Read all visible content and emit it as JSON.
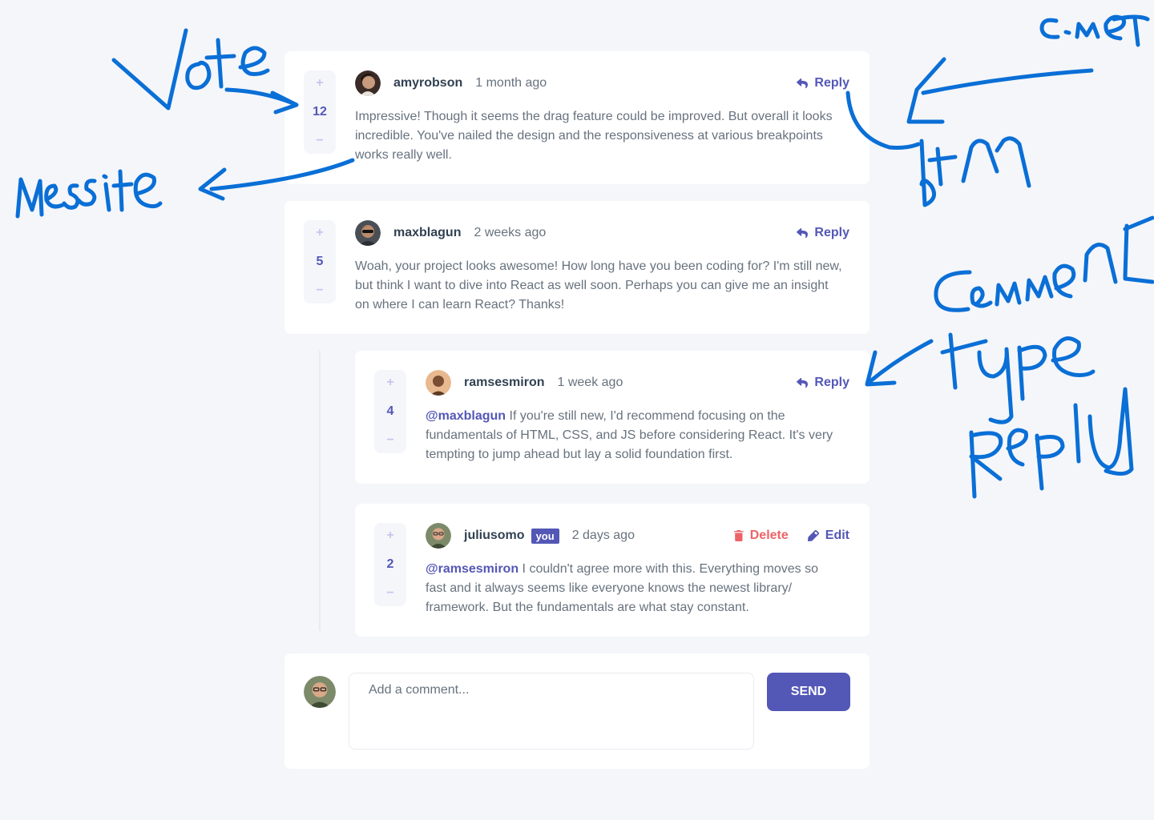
{
  "colors": {
    "moderate_blue": "#5357b6",
    "light_grayish_blue": "#c5c6ef",
    "soft_red": "#ed6368",
    "dark_blue": "#324152",
    "grayish_blue": "#67727e",
    "annotation_blue": "#0a6fd6"
  },
  "comments": [
    {
      "score": "12",
      "username": "amyrobson",
      "time": "1 month ago",
      "reply_label": "Reply",
      "content": "Impressive! Though it seems the drag feature could be improved. But overall it looks incredible. You've nailed the design and the responsiveness at various breakpoints works really well."
    },
    {
      "score": "5",
      "username": "maxblagun",
      "time": "2 weeks ago",
      "reply_label": "Reply",
      "content": "Woah, your project looks awesome! How long have you been coding for? I'm still new, but think I want to dive into React as well soon. Perhaps you can give me an insight on where I can learn React? Thanks!"
    }
  ],
  "replies": [
    {
      "score": "4",
      "username": "ramsesmiron",
      "time": "1 week ago",
      "reply_label": "Reply",
      "mention": "@maxblagun",
      "content": "If you're still new, I'd recommend focusing on the fundamentals of HTML, CSS, and JS before considering React. It's very tempting to jump ahead but lay a solid foundation first."
    },
    {
      "score": "2",
      "username": "juliusomo",
      "you_label": "you",
      "time": "2 days ago",
      "delete_label": "Delete",
      "edit_label": "Edit",
      "mention": "@ramsesmiron",
      "content": "I couldn't agree more with this. Everything moves so fast and it always seems like everyone knows the newest library/ framework. But the fundamentals are what stay constant."
    }
  ],
  "vote_plus": "+",
  "vote_minus": "−",
  "composer": {
    "placeholder": "Add a comment...",
    "send_label": "SEND"
  }
}
